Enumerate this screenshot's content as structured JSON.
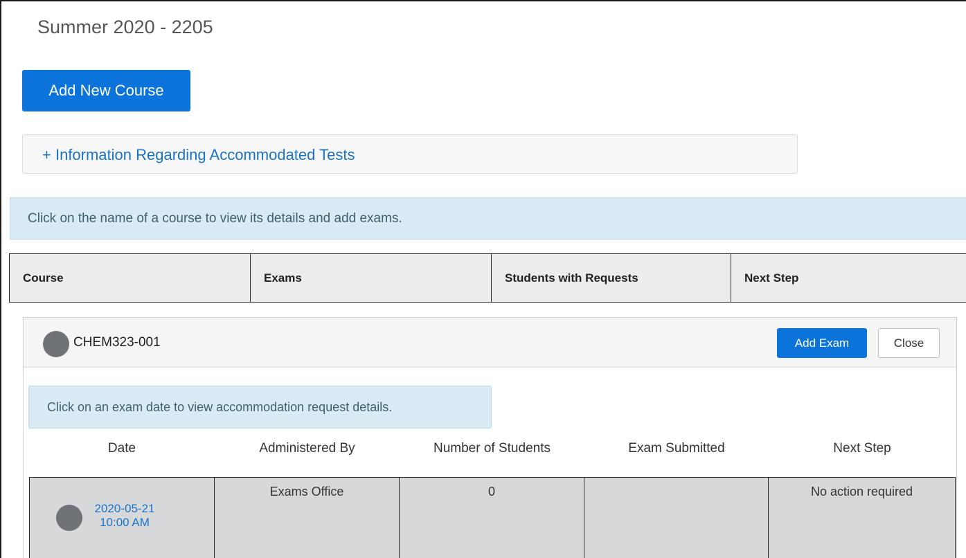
{
  "page": {
    "term_title": "Summer 2020 - 2205",
    "add_course_label": "Add New Course",
    "info_link_label": "+ Information Regarding Accommodated Tests",
    "hint_text": "Click on the name of a course to view its details and add exams."
  },
  "course_table": {
    "columns": [
      "Course",
      "Exams",
      "Students with Requests",
      "Next Step"
    ]
  },
  "course": {
    "code": "CHEM323-001",
    "add_exam_label": "Add Exam",
    "close_label": "Close",
    "exam_hint": "Click on an exam date to view accommodation request details.",
    "exam_columns": [
      "Date",
      "Administered By",
      "Number of Students",
      "Exam Submitted",
      "Next Step"
    ],
    "exams": [
      {
        "date": "2020-05-21",
        "time": "10:00 AM",
        "administered_by": "Exams Office",
        "num_students": "0",
        "exam_submitted": "",
        "next_step": "No action required"
      }
    ]
  },
  "colors": {
    "primary": "#0b73da",
    "link": "#1a73c9",
    "info_bg": "#d8ebf5",
    "row_bg": "#d6d8da"
  }
}
